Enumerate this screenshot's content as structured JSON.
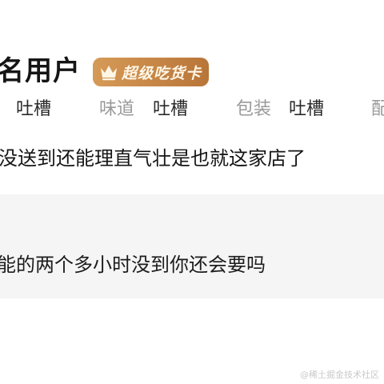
{
  "user": {
    "name": "名用户",
    "badge_label": "超级吃货卡",
    "badge_icon": "crown-icon",
    "badge_colors": [
      "#d69a57",
      "#b87538"
    ]
  },
  "ratings": [
    {
      "label": "",
      "value": "吐槽"
    },
    {
      "label": "味道",
      "value": "吐槽"
    },
    {
      "label": "包装",
      "value": "吐槽"
    },
    {
      "label": "配",
      "value": ""
    }
  ],
  "review": {
    "text": "没送到还能理直气壮是也就这家店了"
  },
  "reply": {
    "text": "能的两个多小时没到你还会要吗"
  },
  "watermark": "@稀土掘金技术社区"
}
